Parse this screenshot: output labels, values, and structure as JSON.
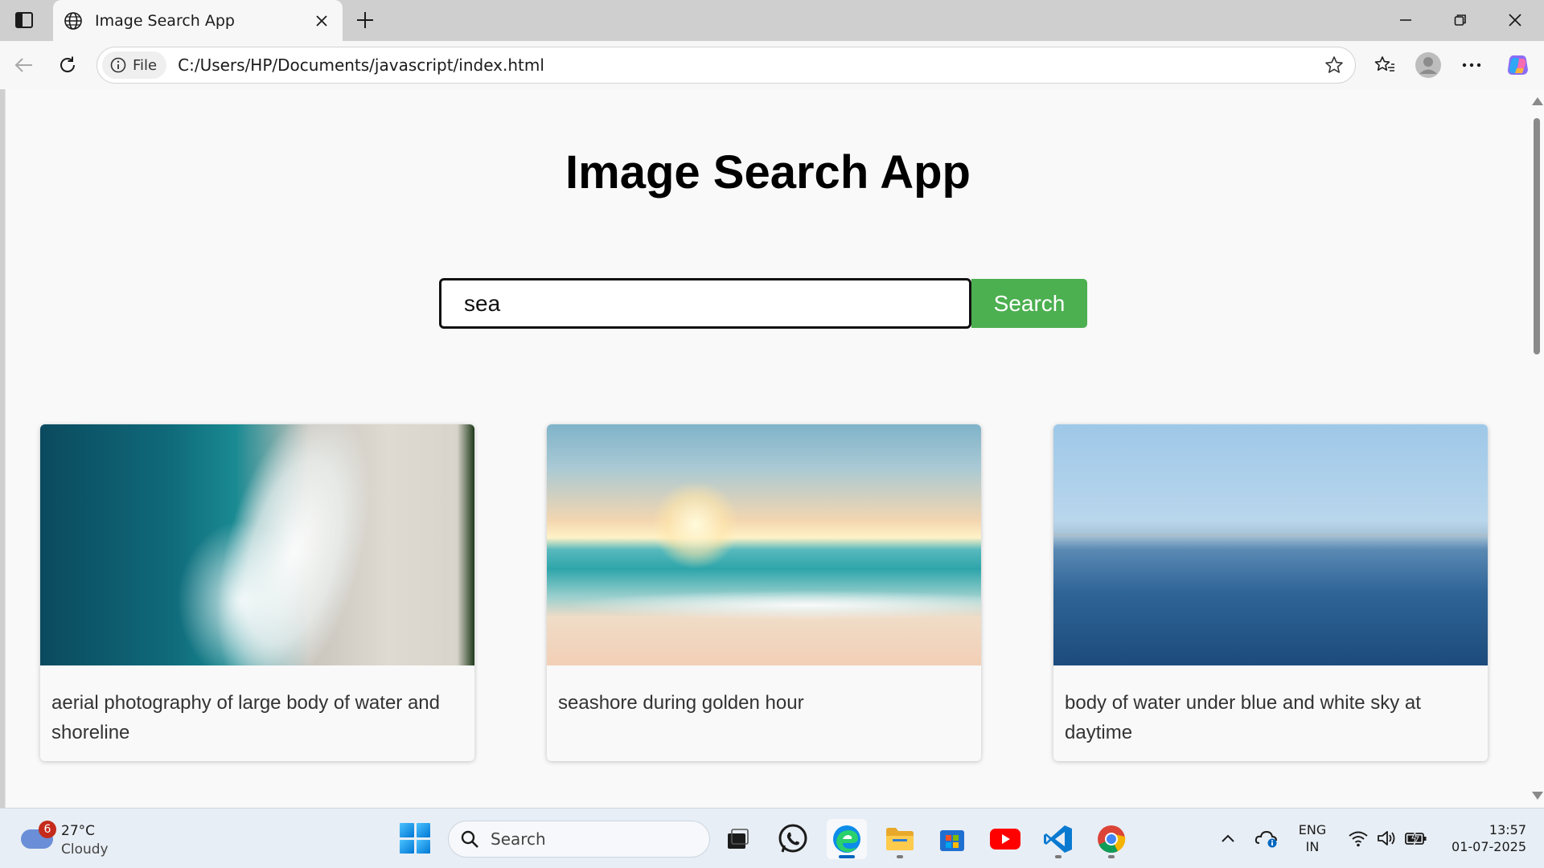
{
  "browser": {
    "tab_title": "Image Search App",
    "site_info_label": "File",
    "url": "C:/Users/HP/Documents/javascript/index.html"
  },
  "page": {
    "title": "Image Search App",
    "search": {
      "value": "sea",
      "button_label": "Search"
    },
    "results": [
      {
        "caption": "aerial photography of large body of water and shoreline"
      },
      {
        "caption": "seashore during golden hour"
      },
      {
        "caption": "body of water under blue and white sky at daytime"
      }
    ]
  },
  "taskbar": {
    "weather_badge": "6",
    "weather_temp": "27°C",
    "weather_condition": "Cloudy",
    "search_label": "Search",
    "language_top": "ENG",
    "language_bottom": "IN",
    "time": "13:57",
    "date": "01-07-2025"
  },
  "colors": {
    "search_button": "#4caf50",
    "page_background": "#f9f9f9",
    "chrome_background": "#cfcfcf"
  },
  "icons": [
    "sidebar-icon",
    "globe-icon",
    "close-icon",
    "plus-icon",
    "minimize-icon",
    "restore-icon",
    "back-icon",
    "refresh-icon",
    "info-icon",
    "star-icon",
    "favorites-icon",
    "profile-icon",
    "more-icon",
    "copilot-icon"
  ]
}
